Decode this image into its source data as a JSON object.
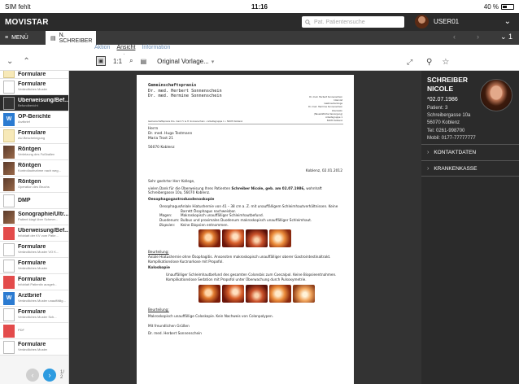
{
  "status_bar": {
    "carrier": "SIM fehlt",
    "time": "11:16",
    "battery": "40 %",
    "battery_level": 0.4
  },
  "app": {
    "brand": "MOVISTAR",
    "search_placeholder": "Pat. Patientensuche",
    "user": "USER01"
  },
  "tabs": {
    "menu_label": "MENÜ",
    "patient_tab": "N. SCHREIBER"
  },
  "subtabs": [
    "Aktion",
    "Ansicht",
    "Information"
  ],
  "toolbar": {
    "ratio": "1:1",
    "template": "Original Vorlage..."
  },
  "sidebar": {
    "items": [
      {
        "title": "Formulare",
        "subtitle": "",
        "thumb": "yellow",
        "partial": true
      },
      {
        "title": "Formulare",
        "subtitle": "Verändliches Muster",
        "thumb": "doc"
      },
      {
        "title": "Überweisung/Bef...",
        "subtitle": "Befundbericht",
        "thumb": "dark",
        "active": true
      },
      {
        "title": "OP-Berichte",
        "subtitle": "Arztbrief",
        "thumb": "blue",
        "glyph": "W"
      },
      {
        "title": "Formulare",
        "subtitle": "AU-Bescheinigung",
        "thumb": "yellow"
      },
      {
        "title": "Röntgen",
        "subtitle": "Verletzung des Fußballen",
        "thumb": "photo"
      },
      {
        "title": "Röntgen",
        "subtitle": "Kontrollaufnahme nach weg...",
        "thumb": "photo"
      },
      {
        "title": "Röntgen",
        "subtitle": "Operation des Bruchs",
        "thumb": "photo"
      },
      {
        "title": "DMP",
        "subtitle": "",
        "thumb": "doc"
      },
      {
        "title": "Sonographie/Ultr...",
        "subtitle": "Patient klagt über Schmer...",
        "thumb": "photo"
      },
      {
        "title": "Überweisung/Bef...",
        "subtitle": "Infoblatt der KV vom Patie...",
        "thumb": "red"
      },
      {
        "title": "Formulare",
        "subtitle": "Verändliches Muster VO K...",
        "thumb": "doc"
      },
      {
        "title": "Formulare",
        "subtitle": "Verändliches Muster",
        "thumb": "doc"
      },
      {
        "title": "Formulare",
        "subtitle": "Infoblatt Patientin ausgeh...",
        "thumb": "red"
      },
      {
        "title": "Arztbrief",
        "subtitle": "Verändliches Muster unauffällig...",
        "thumb": "blue",
        "glyph": "W"
      },
      {
        "title": "Formulare",
        "subtitle": "Verändliches Muster Sch...",
        "thumb": "doc"
      },
      {
        "title": "",
        "subtitle": "PDF",
        "thumb": "red"
      },
      {
        "title": "Formulare",
        "subtitle": "Verändliches Muster",
        "thumb": "doc"
      }
    ],
    "page_current": "1/",
    "page_total": "2"
  },
  "letter": {
    "firm_title": "Gemeinschaftspraxis",
    "firm_line1": "Dr. med. Herbert Sonnenschein",
    "firm_line2": "Dr. med. Hermine Sonnenschein",
    "header_right": [
      "Dr. med. Herbert Sonnenschein",
      "Internist",
      "Gastroenterologe",
      "Dr. med. Hermine Sonnenschein",
      "Internistin",
      "(Hausärztliche Versorgung)",
      "Arbeitsgruppe 1",
      "56070 Koblenz"
    ],
    "sender_line": "Gemeinschaftspraxis Drs. med. H. & H. Sonnenschein • Arbeitsgruppe 1 • 56070 Koblenz",
    "sender_right": "",
    "address": [
      "Herrn",
      "Dr. med. Hugo Testmann",
      "Maria Trost 21",
      "",
      "56070 Koblenz"
    ],
    "date": "Koblenz, 02.01.2012",
    "salutation": "Sehr geehrter Herr Kollege,",
    "intro_pre": "vielen Dank für die Überweisung Ihres Patienten ",
    "intro_bold": "Schreiber Nicole, geb. am 02.07.1986,",
    "intro_post": " wohnhaft Schreibergasse 10a, 56070 Koblenz.",
    "section1_title": "Oesophagogastroduodenoskopie",
    "findings1": [
      {
        "k": "Oesophagus:",
        "v": "Anlale Hiatushernie von 41 – 38 cm a. Z. mit unauffälligem Schleimhautverhältnissen. Keine Barrett Ösophagus nachweisbar."
      },
      {
        "k": "Magen:",
        "v": "Makroskopisch unauffälliger Schleimhautbefund."
      },
      {
        "k": "Duodenum:",
        "v": "Bulbus und proximales Duodenum makroskopisch unauffälliger Schleimhaut."
      },
      {
        "k": "Biopsien:",
        "v": "Keine Biopsien entnommen."
      }
    ],
    "beurteilung_label": "Beurteilung:",
    "beurteilung1": "Axiale Hiatushernie ohne Ösophagitis. Ansonsten makroskopisch unauffälliger oberer Gastrointestinaltrakt. Komplikationslose Kurznarkose mit Propofol.",
    "section2_title": "Koloskopie",
    "findings2": "Unauffälliger Schleimhautbefund des gesamten Colonsbis zum Coecalpol. Keine Biopsieentnahmen. Komplikationslose Sedation mit Propofol unter Überwachung durch Pulsoxymetrie.",
    "beurteilung2_label": "Beurteilung:",
    "beurteilung2": "Makroskopisch unauffällige Coloskopie. Kein Nachweis von Colonpolypen.",
    "closing": "Mit freundlichen Grüßen",
    "signature": "Dr. med. Herbert Sonnenschein"
  },
  "patient": {
    "last_name": "SCHREIBER",
    "first_name": "NICOLE",
    "dob": "*02.07.1986",
    "patient_no": "Patient: 3",
    "street": "Schreibergasse 10a",
    "city": "56070 Koblenz",
    "tel": "Tel: 0261-998700",
    "mobile": "Mobil: 0177-77777777",
    "section_kontakt": "KONTAKTDATEN",
    "section_kasse": "KRANKENKASSE"
  }
}
